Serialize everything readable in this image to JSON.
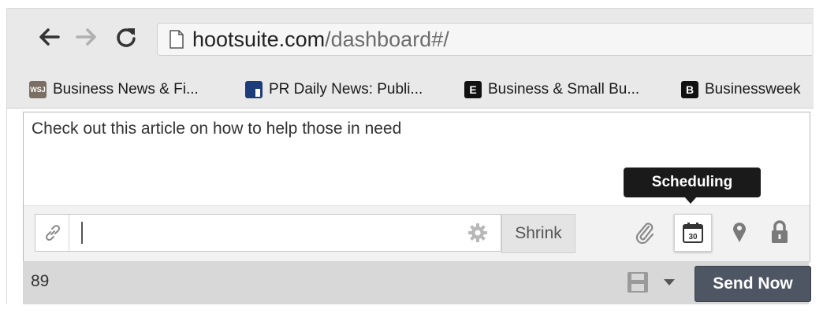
{
  "browser": {
    "url_host": "hootsuite.com",
    "url_path": "/dashboard#/",
    "bookmarks": [
      {
        "label": "Business News & Fi...",
        "icon": "wsj-icon",
        "icon_text": "WSJ",
        "color": "#7a6f62"
      },
      {
        "label": "PR Daily News: Publi...",
        "icon": "prdaily-icon",
        "icon_text": "",
        "color": "#1f3c7a"
      },
      {
        "label": "Business & Small Bu...",
        "icon": "entrepreneur-icon",
        "icon_text": "E",
        "color": "#111111"
      },
      {
        "label": "Businessweek",
        "icon": "businessweek-icon",
        "icon_text": "B",
        "color": "#111111"
      }
    ]
  },
  "composer": {
    "message": "Check out this article on how to help those in need",
    "link_input_value": "",
    "shrink_label": "Shrink",
    "tooltip": "Scheduling",
    "calendar_day": "30"
  },
  "footer": {
    "char_count": "89",
    "send_label": "Send Now"
  },
  "colors": {
    "toolbar_bg": "#e9e9e9",
    "send_button": "#4e5663",
    "tooltip_bg": "#1a1a1a"
  }
}
